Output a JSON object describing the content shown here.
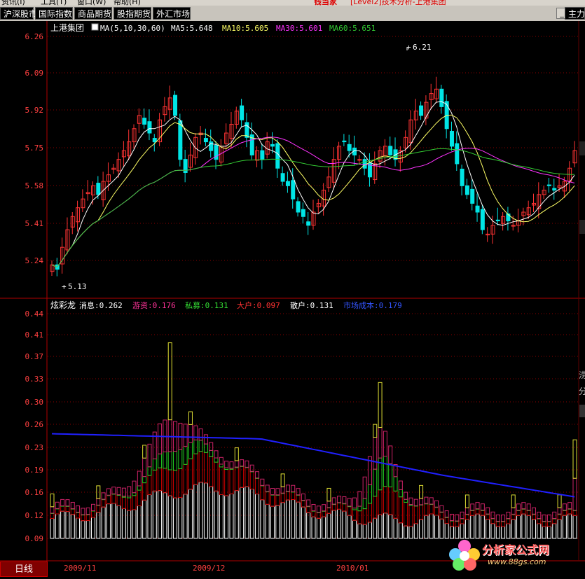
{
  "menu": {
    "items": [
      "资讯(I)",
      "工具(T)",
      "窗口(W)",
      "帮助(H)"
    ],
    "title": "钱当家",
    "title_rest": "[Level2]技术分析-上港集团"
  },
  "tabs": [
    "沪深股市",
    "国际指数",
    "商品期货",
    "股指期货",
    "外汇市场"
  ],
  "tab_right": "主力",
  "window_buttons": {
    "minimize": "_",
    "maximize": "□"
  },
  "price_panel": {
    "stock_name": "上港集团",
    "ma_label": "MA(5,10,30,60)",
    "ma5_label": "MA5:5.648",
    "ma10_label": "MA10:5.605",
    "ma30_label": "MA30:5.601",
    "ma60_label": "MA60:5.651",
    "y_ticks": [
      "6.26",
      "6.09",
      "5.92",
      "5.75",
      "5.58",
      "5.41",
      "5.24"
    ],
    "high_marker": "6.21",
    "low_marker": "5.13",
    "right_edge_labels": [
      "涝",
      "分"
    ]
  },
  "indicator_panel": {
    "name": "炫彩龙",
    "xiaoxi": "消息:0.262",
    "youzi": "游资:0.176",
    "simu": "私募:0.131",
    "dahu": "大户:0.097",
    "sanhu": "散户:0.131",
    "cost": "市场成本:0.179",
    "y_ticks": [
      "0.44",
      "0.41",
      "0.37",
      "0.33",
      "0.30",
      "0.26",
      "0.23",
      "0.19",
      "0.16",
      "0.12",
      "0.09"
    ]
  },
  "x_axis": {
    "dates": [
      "2009/11",
      "2009/12",
      "2010/01"
    ],
    "period": "日线"
  },
  "colors": {
    "up": "#ff3333",
    "down": "#00e5e5",
    "ma5": "#ffffff",
    "ma10": "#ffff66",
    "ma30": "#ff33ff",
    "ma60": "#33cc33",
    "grid": "#8b0000",
    "cost_line": "#2020ff",
    "sanhu": "#ffffff",
    "dahu": "#cc0000",
    "simu": "#22cc22",
    "youzi": "#cc2266",
    "xiaoxi": "#dddd33"
  },
  "watermark": {
    "title": "分析家公式网",
    "url": "www.88gs.com"
  }
}
